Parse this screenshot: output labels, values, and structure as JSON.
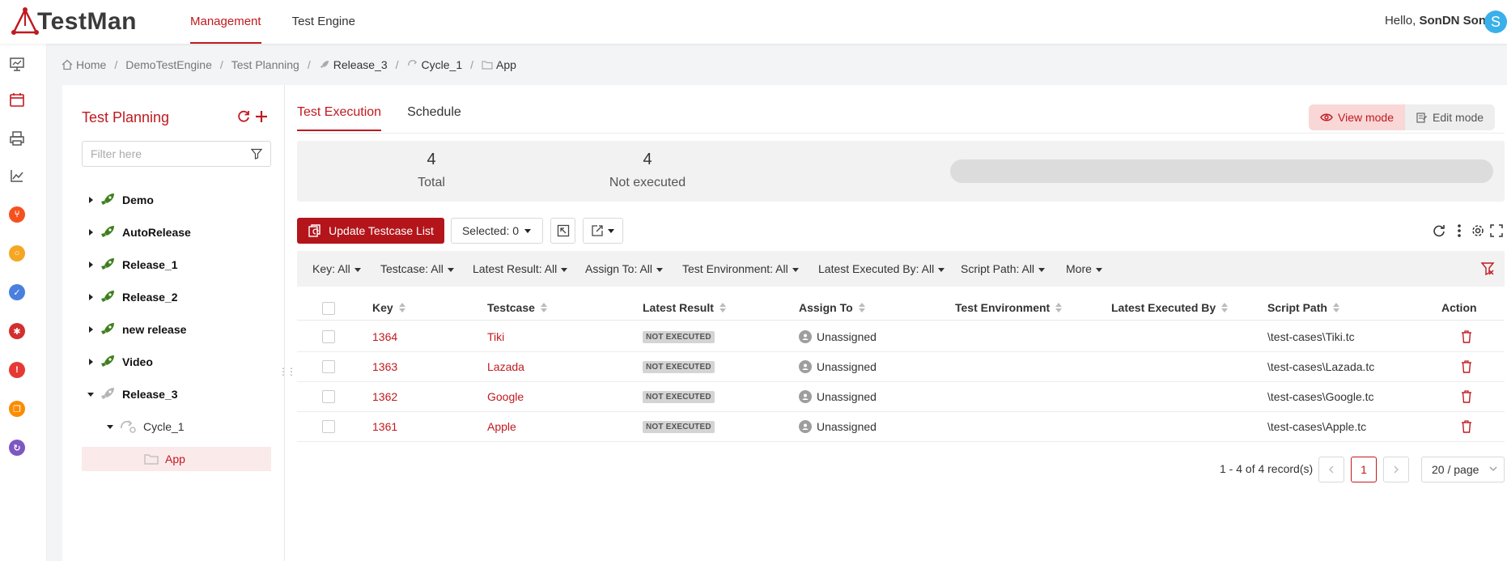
{
  "app": {
    "name": "TestMan"
  },
  "topnav": {
    "items": [
      "Management",
      "Test Engine"
    ],
    "active": "Management"
  },
  "user": {
    "greeting": "Hello,",
    "name": "SonDN Son",
    "avatar_letter": "S"
  },
  "sidebar_icons": [
    "presentation-icon",
    "calendar-icon",
    "printer-icon",
    "chart-line-icon",
    "git-icon",
    "lightbulb-icon",
    "check-circle-icon",
    "bug-icon",
    "alert-icon",
    "copy-icon",
    "sync-icon"
  ],
  "breadcrumb": [
    "Home",
    "DemoTestEngine",
    "Test Planning",
    "Release_3",
    "Cycle_1",
    "App"
  ],
  "tree": {
    "title": "Test Planning",
    "filter_placeholder": "Filter here",
    "nodes": [
      {
        "label": "Demo"
      },
      {
        "label": "AutoRelease"
      },
      {
        "label": "Release_1"
      },
      {
        "label": "Release_2"
      },
      {
        "label": "new release"
      },
      {
        "label": "Video"
      },
      {
        "label": "Release_3"
      },
      {
        "label": "Cycle_1"
      },
      {
        "label": "App"
      }
    ]
  },
  "tabs": [
    "Test Execution",
    "Schedule"
  ],
  "modes": {
    "view": "View mode",
    "edit": "Edit mode"
  },
  "stats": {
    "total": {
      "value": "4",
      "label": "Total"
    },
    "not_executed": {
      "value": "4",
      "label": "Not executed"
    },
    "executed_fraction": 0
  },
  "toolbar": {
    "update_label": "Update Testcase List",
    "selected_label": "Selected: 0"
  },
  "filters": [
    "Key: All",
    "Testcase: All",
    "Latest Result: All",
    "Assign To: All",
    "Test Environment: All",
    "Latest Executed By: All",
    "Script Path: All",
    "More"
  ],
  "table": {
    "headers": [
      "Key",
      "Testcase",
      "Latest Result",
      "Assign To",
      "Test Environment",
      "Latest Executed By",
      "Script Path",
      "Action"
    ],
    "rows": [
      {
        "key": "1364",
        "testcase": "Tiki",
        "result": "NOT EXECUTED",
        "assign": "Unassigned",
        "env": "",
        "executed_by": "",
        "path": "\\test-cases\\Tiki.tc"
      },
      {
        "key": "1363",
        "testcase": "Lazada",
        "result": "NOT EXECUTED",
        "assign": "Unassigned",
        "env": "",
        "executed_by": "",
        "path": "\\test-cases\\Lazada.tc"
      },
      {
        "key": "1362",
        "testcase": "Google",
        "result": "NOT EXECUTED",
        "assign": "Unassigned",
        "env": "",
        "executed_by": "",
        "path": "\\test-cases\\Google.tc"
      },
      {
        "key": "1361",
        "testcase": "Apple",
        "result": "NOT EXECUTED",
        "assign": "Unassigned",
        "env": "",
        "executed_by": "",
        "path": "\\test-cases\\Apple.tc"
      }
    ]
  },
  "pagination": {
    "info": "1 - 4 of 4 record(s)",
    "current": "1",
    "page_size": "20 / page"
  },
  "colors": {
    "accent": "#c0191f",
    "rocket": "#3f7f1f"
  }
}
